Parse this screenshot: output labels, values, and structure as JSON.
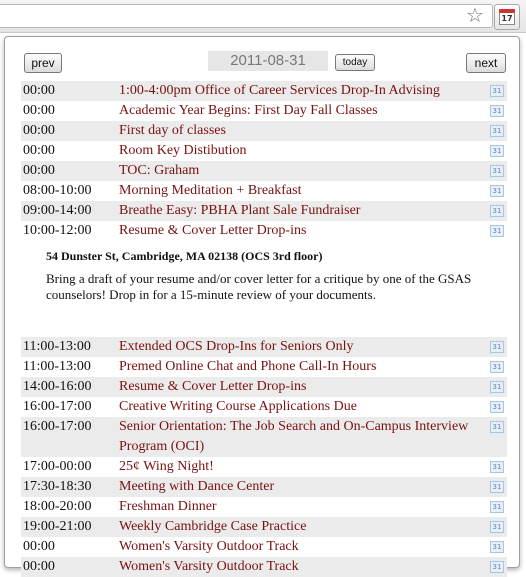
{
  "toolbar": {
    "calendar_day": "17"
  },
  "nav": {
    "prev_label": "prev",
    "next_label": "next",
    "today_label": "today",
    "date_value": "2011-08-31"
  },
  "detail": {
    "location": "54 Dunster St, Cambridge, MA 02138 (OCS 3rd floor)",
    "description": "Bring a draft of your resume and/or cover letter for a critique by one of the GSAS counselors! Drop in for a 15-minute review of your documents."
  },
  "gcal_icon_text": "31",
  "events_before": [
    {
      "time": "00:00",
      "title": "1:00-4:00pm Office of Career Services Drop-In Advising"
    },
    {
      "time": "00:00",
      "title": "Academic Year Begins: First Day Fall Classes"
    },
    {
      "time": "00:00",
      "title": "First day of classes"
    },
    {
      "time": "00:00",
      "title": "Room Key Distibution"
    },
    {
      "time": "00:00",
      "title": "TOC: Graham"
    },
    {
      "time": "08:00-10:00",
      "title": "Morning Meditation + Breakfast"
    },
    {
      "time": "09:00-14:00",
      "title": "Breathe Easy: PBHA Plant Sale Fundraiser"
    },
    {
      "time": "10:00-12:00",
      "title": "Resume & Cover Letter Drop-ins"
    }
  ],
  "events_after": [
    {
      "time": "11:00-13:00",
      "title": "Extended OCS Drop-Ins for Seniors Only"
    },
    {
      "time": "11:00-13:00",
      "title": "Premed Online Chat and Phone Call-In Hours"
    },
    {
      "time": "14:00-16:00",
      "title": "Resume & Cover Letter Drop-ins"
    },
    {
      "time": "16:00-17:00",
      "title": "Creative Writing Course Applications Due"
    },
    {
      "time": "16:00-17:00",
      "title": "Senior Orientation: The Job Search and On-Campus Interview Program (OCI)",
      "tall": true
    },
    {
      "time": "17:00-00:00",
      "title": "25¢ Wing Night!"
    },
    {
      "time": "17:30-18:30",
      "title": "Meeting with Dance Center"
    },
    {
      "time": "18:00-20:00",
      "title": "Freshman Dinner"
    },
    {
      "time": "19:00-21:00",
      "title": "Weekly Cambridge Case Practice"
    },
    {
      "time": "00:00",
      "title": "Women's Varsity Outdoor Track"
    },
    {
      "time": "00:00",
      "title": "Women's Varsity Outdoor Track"
    }
  ]
}
